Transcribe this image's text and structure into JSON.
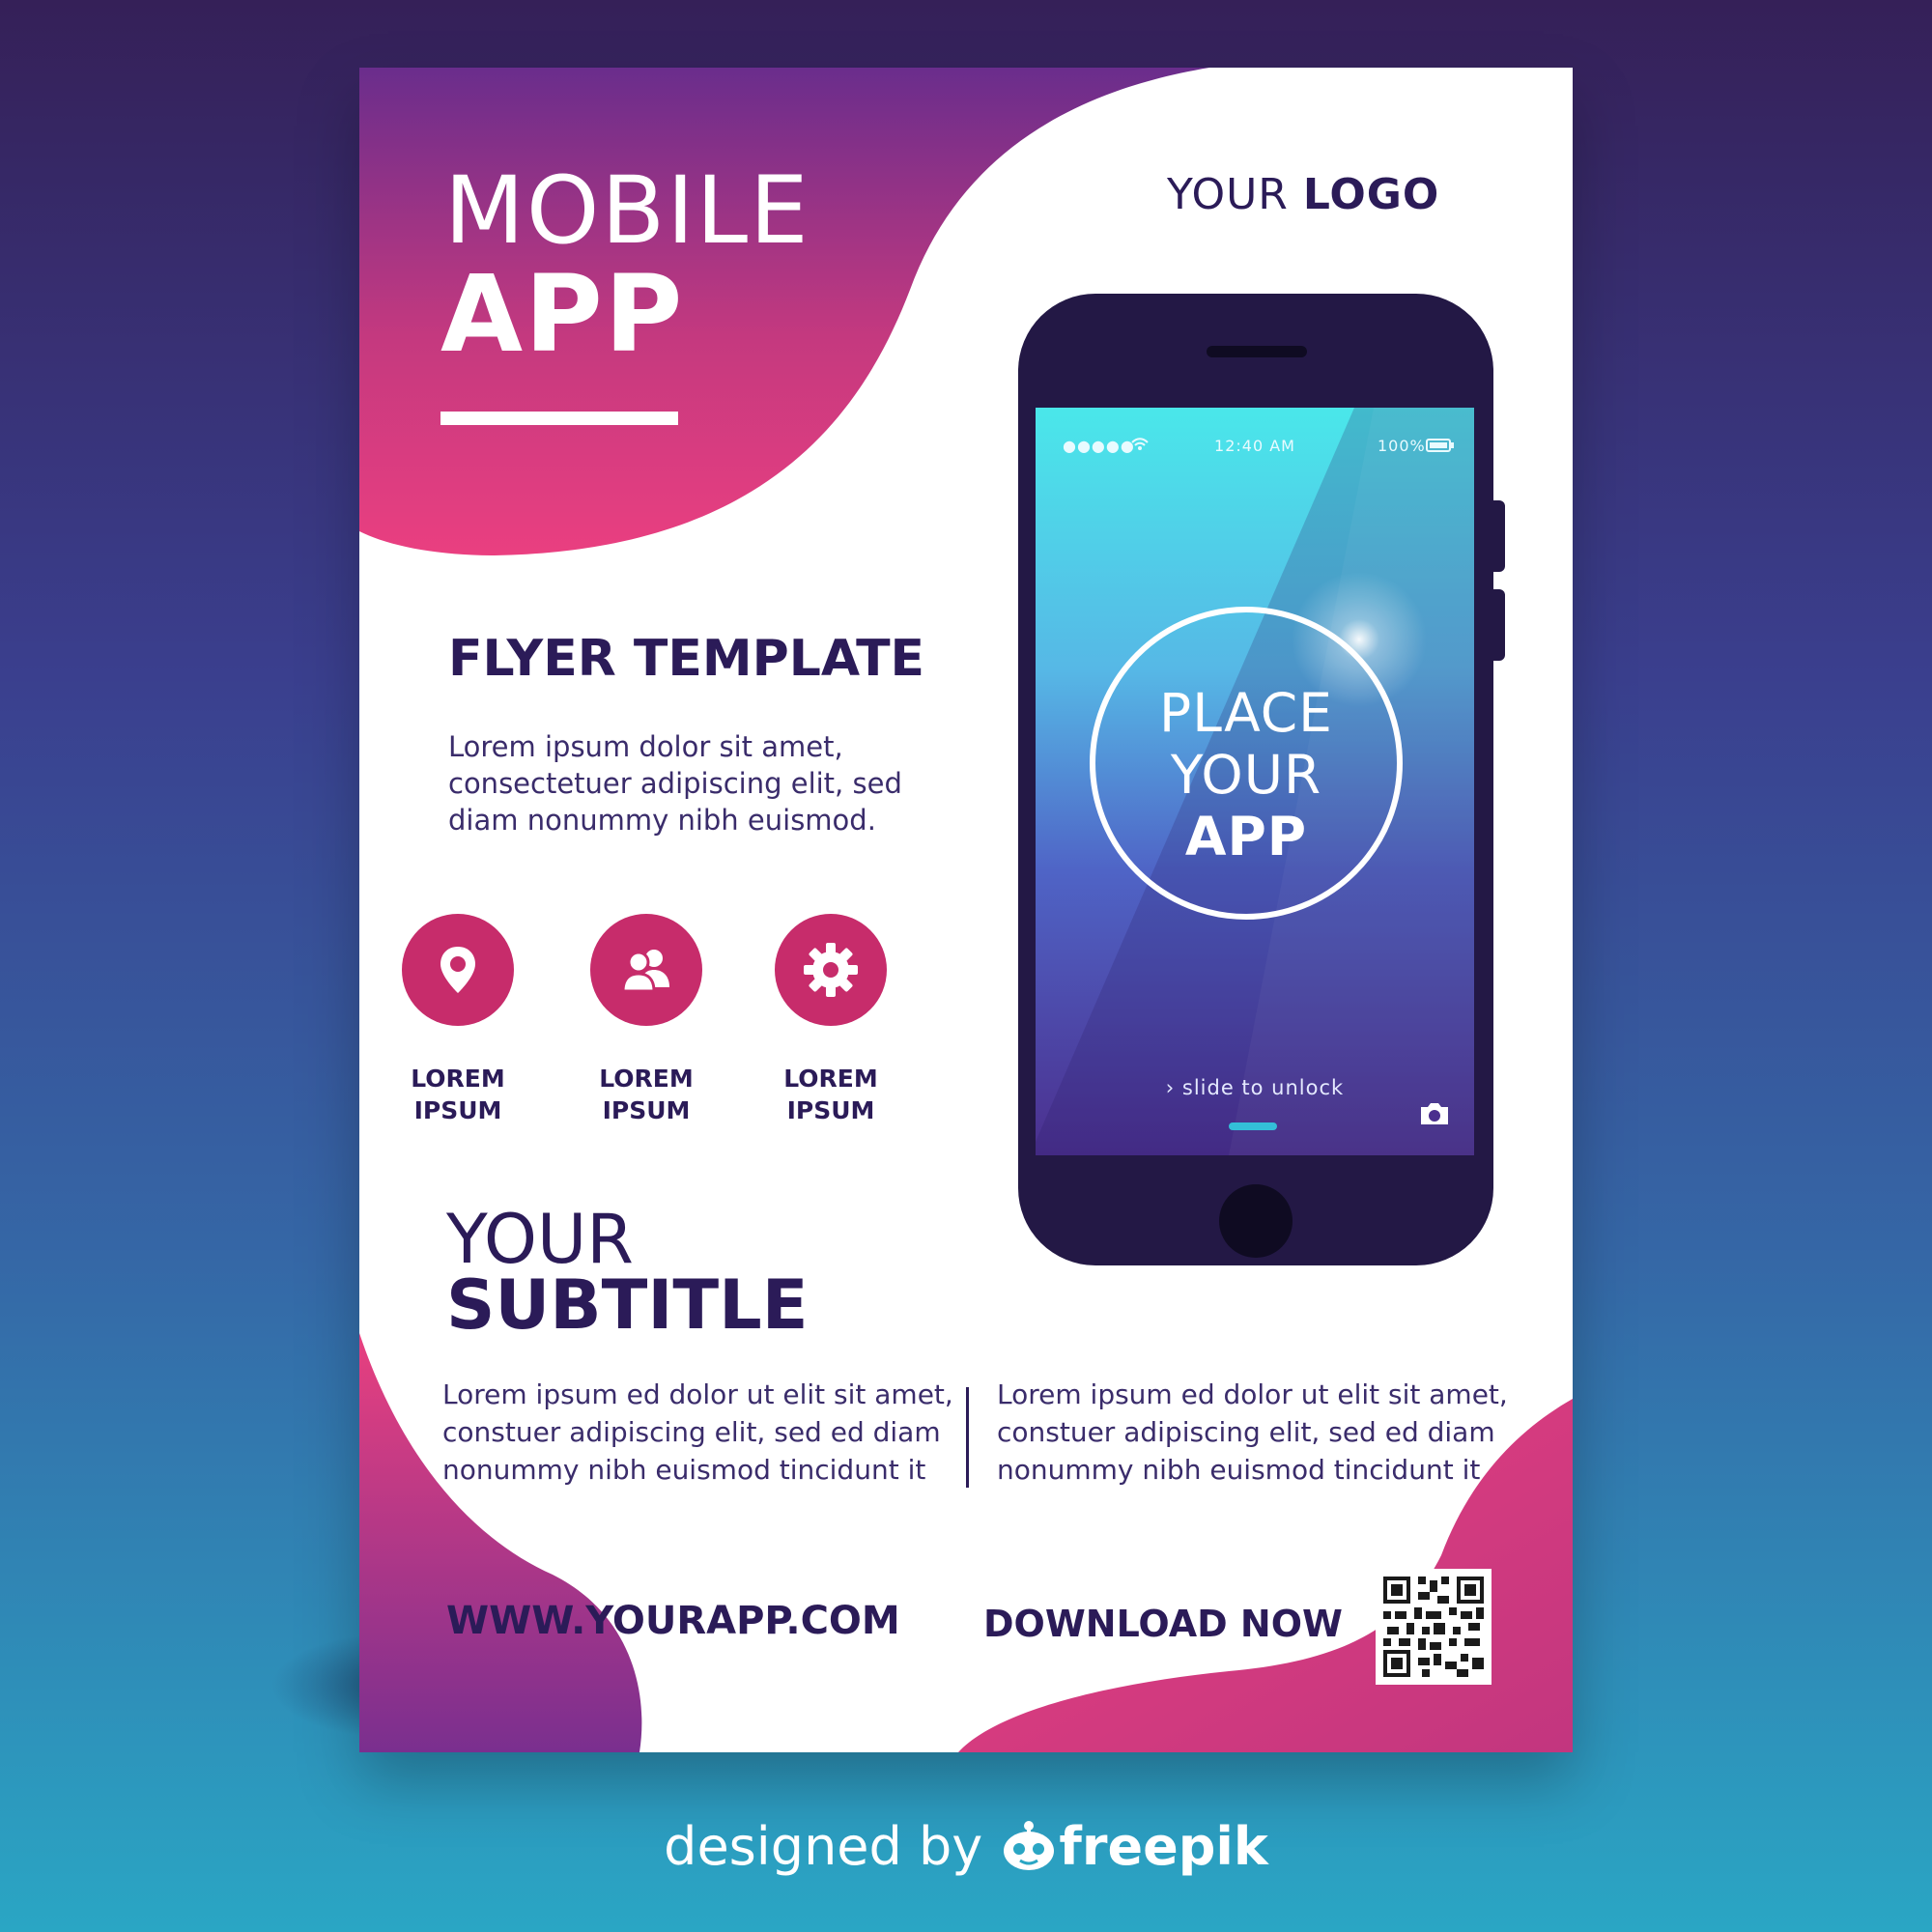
{
  "flyer": {
    "title_line1": "MOBILE",
    "title_line2": "APP",
    "logo_light": "YOUR ",
    "logo_bold": "LOGO",
    "section_heading": "FLYER TEMPLATE",
    "intro_text": "Lorem ipsum dolor sit amet, consectetuer adipiscing elit, sed diam nonummy nibh euismod.",
    "features": [
      {
        "icon": "location-pin-icon",
        "line1": "LOREM",
        "line2": "IPSUM"
      },
      {
        "icon": "users-icon",
        "line1": "LOREM",
        "line2": "IPSUM"
      },
      {
        "icon": "gear-icon",
        "line1": "LOREM",
        "line2": "IPSUM"
      }
    ],
    "subtitle_line1": "YOUR",
    "subtitle_line2": "SUBTITLE",
    "paragraph_left": "Lorem ipsum ed dolor ut elit sit amet, constuer adipiscing elit, sed ed diam nonummy nibh euismod tincidunt it",
    "paragraph_right": "Lorem ipsum ed dolor ut elit sit amet, constuer adipiscing elit, sed ed diam nonummy nibh euismod tincidunt it",
    "website": "WWW.YOURAPP.COM",
    "download": "DOWNLOAD NOW"
  },
  "phone": {
    "status_signal": "●●●●●",
    "status_time": "12:40 AM",
    "status_battery": "100%",
    "screen_line1": "PLACE",
    "screen_line2": "YOUR",
    "screen_line3": "APP",
    "unlock_text": "slide to unlock"
  },
  "credit": {
    "prefix": "designed by ",
    "brand": "freepik"
  },
  "colors": {
    "accent_pink": "#e8407f",
    "accent_purple": "#6a2b8a",
    "text_navy": "#2b1b58",
    "icon_circle": "#c72c6b"
  }
}
